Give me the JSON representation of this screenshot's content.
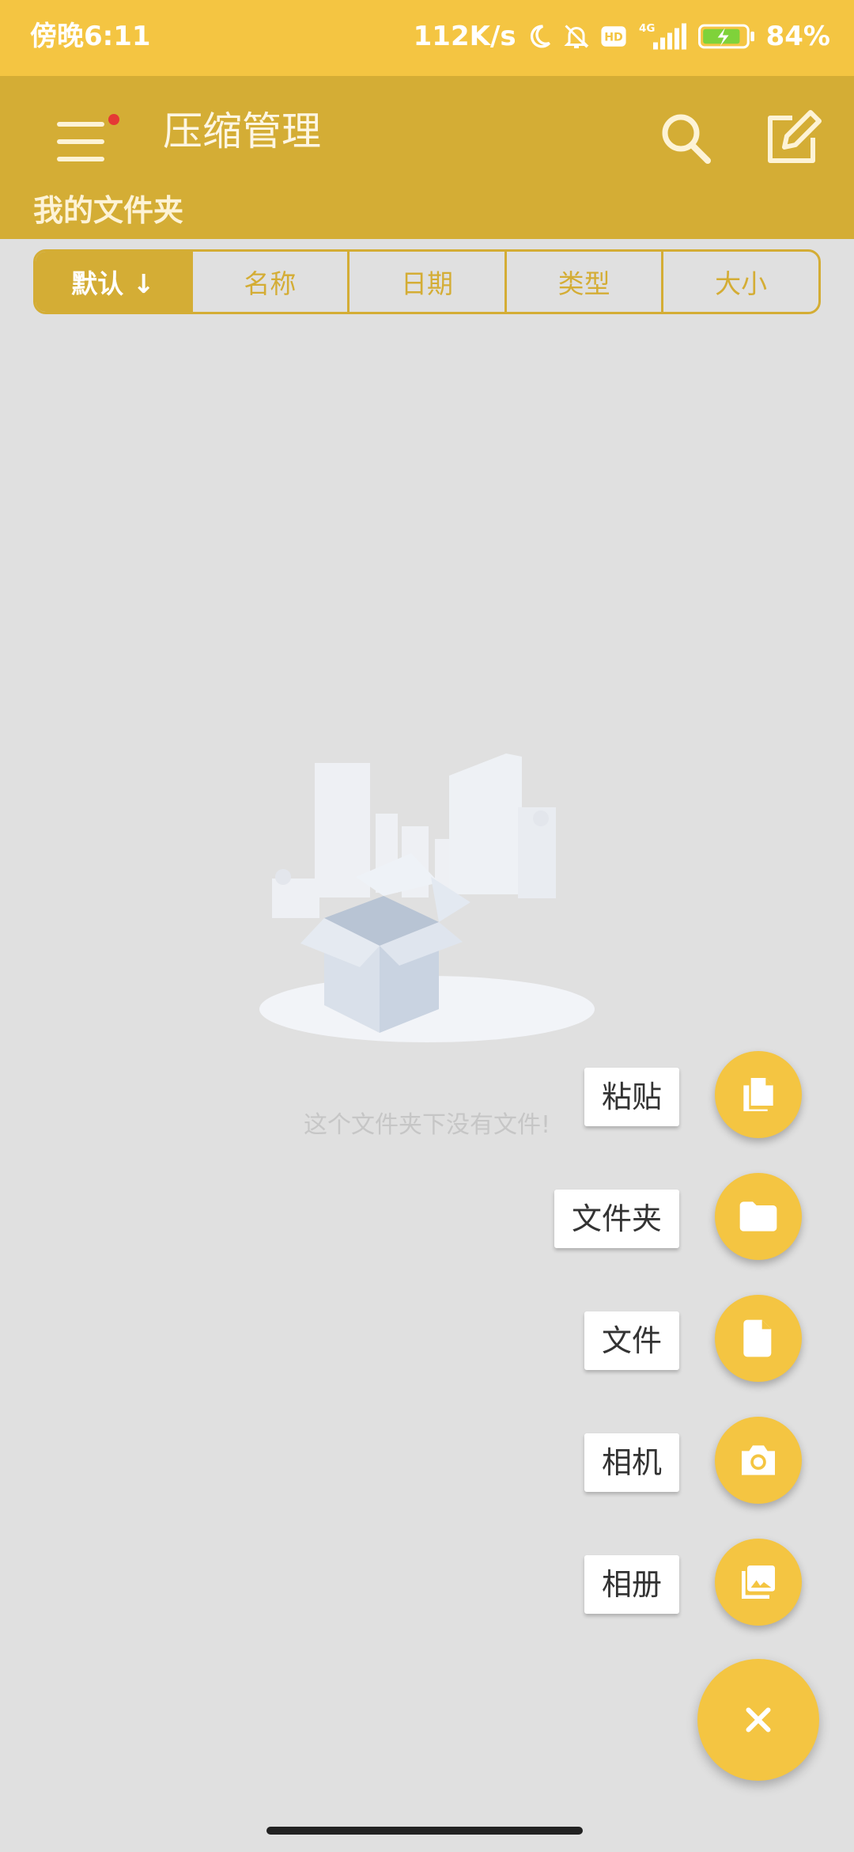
{
  "status_bar": {
    "time": "傍晚6:11",
    "net_speed": "112K/s",
    "battery": "84%",
    "icons": [
      "moon-icon",
      "bell-off-icon",
      "hd-icon",
      "signal-4g-icon",
      "battery-charging-icon"
    ]
  },
  "app_bar": {
    "title": "压缩管理",
    "folder": "我的文件夹",
    "icons": [
      "menu-icon",
      "search-icon",
      "edit-icon"
    ],
    "accent": "#d4ad35"
  },
  "sort_tabs": [
    {
      "label": "默认 ↓",
      "active": true
    },
    {
      "label": "名称",
      "active": false
    },
    {
      "label": "日期",
      "active": false
    },
    {
      "label": "类型",
      "active": false
    },
    {
      "label": "大小",
      "active": false
    }
  ],
  "empty_state": {
    "message": "这个文件夹下没有文件!"
  },
  "fab_menu": {
    "items": [
      {
        "label": "粘贴",
        "icon": "paste-icon"
      },
      {
        "label": "文件夹",
        "icon": "folder-icon"
      },
      {
        "label": "文件",
        "icon": "file-icon"
      },
      {
        "label": "相机",
        "icon": "camera-icon"
      },
      {
        "label": "相册",
        "icon": "gallery-icon"
      }
    ],
    "close_icon": "close-icon",
    "color": "#f4c542"
  }
}
